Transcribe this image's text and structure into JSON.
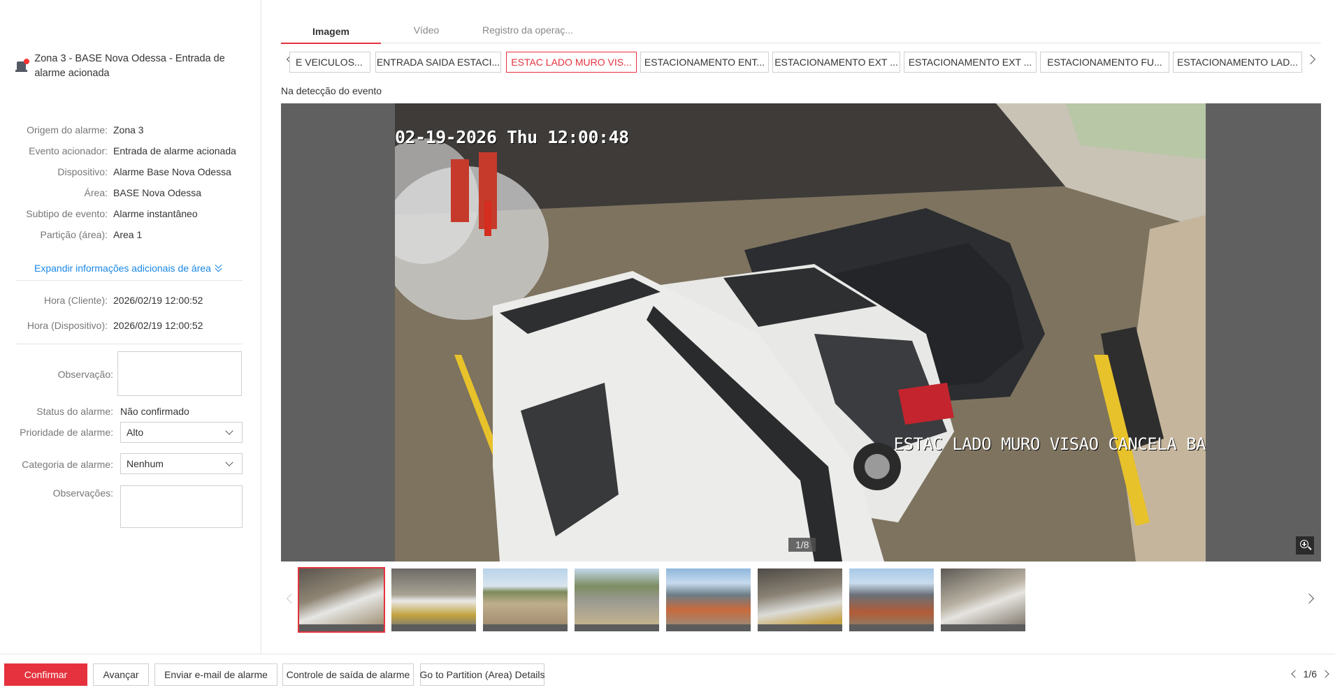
{
  "alarm": {
    "title": "Zona 3 - BASE Nova Odessa - Entrada de alarme acionada"
  },
  "details": [
    {
      "label": "Origem do alarme:",
      "value": "Zona 3"
    },
    {
      "label": "Evento acionador:",
      "value": "Entrada de alarme acionada"
    },
    {
      "label": "Dispositivo:",
      "value": "Alarme Base Nova Odessa"
    },
    {
      "label": "Área:",
      "value": "BASE Nova Odessa"
    },
    {
      "label": "Subtipo de evento:",
      "value": "Alarme instantâneo"
    },
    {
      "label": "Partição (área):",
      "value": "Area 1"
    }
  ],
  "expand_label": "Expandir informações adicionais de área",
  "times": [
    {
      "label": "Hora (Cliente):",
      "value": "2026/02/19 12:00:52"
    },
    {
      "label": "Hora (Dispositivo):",
      "value": "2026/02/19 12:00:52"
    }
  ],
  "form": {
    "observation_label": "Observação:",
    "observation_value": "",
    "status_label": "Status do alarme:",
    "status_value": "Não confirmado",
    "priority_label": "Prioridade de alarme:",
    "priority_value": "Alto",
    "category_label": "Categoria de alarme:",
    "category_value": "Nenhum",
    "remarks_label": "Observações:",
    "remarks_value": ""
  },
  "tabs": [
    {
      "label": "Imagem",
      "active": true
    },
    {
      "label": "Vídeo",
      "active": false
    },
    {
      "label": "Registro da operaç...",
      "active": false
    }
  ],
  "cameras": [
    {
      "label": "E VEICULOS...",
      "active": false
    },
    {
      "label": "ENTRADA SAIDA ESTACI...",
      "active": false
    },
    {
      "label": "ESTAC LADO MURO VIS...",
      "active": true
    },
    {
      "label": "ESTACIONAMENTO ENT...",
      "active": false
    },
    {
      "label": "ESTACIONAMENTO EXT ...",
      "active": false
    },
    {
      "label": "ESTACIONAMENTO EXT ...",
      "active": false
    },
    {
      "label": "ESTACIONAMENTO FU...",
      "active": false
    },
    {
      "label": "ESTACIONAMENTO LAD...",
      "active": false
    }
  ],
  "viewer": {
    "caption": "Na detecção do evento",
    "timestamp": "02-19-2026 Thu 12:00:48",
    "camera_overlay": "ESTAC LADO MURO VISAO CANCELA BA",
    "counter": "1/8",
    "zoom_icon": "zoom-in-icon"
  },
  "thumbnails": {
    "count": 8,
    "selected_index": 0
  },
  "actions": {
    "confirm": "Confirmar",
    "next": "Avançar",
    "email": "Enviar e-mail de alarme",
    "output": "Controle de saída de alarme",
    "partition": "Go to Partition (Area) Details"
  },
  "pager": {
    "text": "1/6"
  },
  "colors": {
    "accent": "#e5323e",
    "link": "#1a87e6"
  }
}
